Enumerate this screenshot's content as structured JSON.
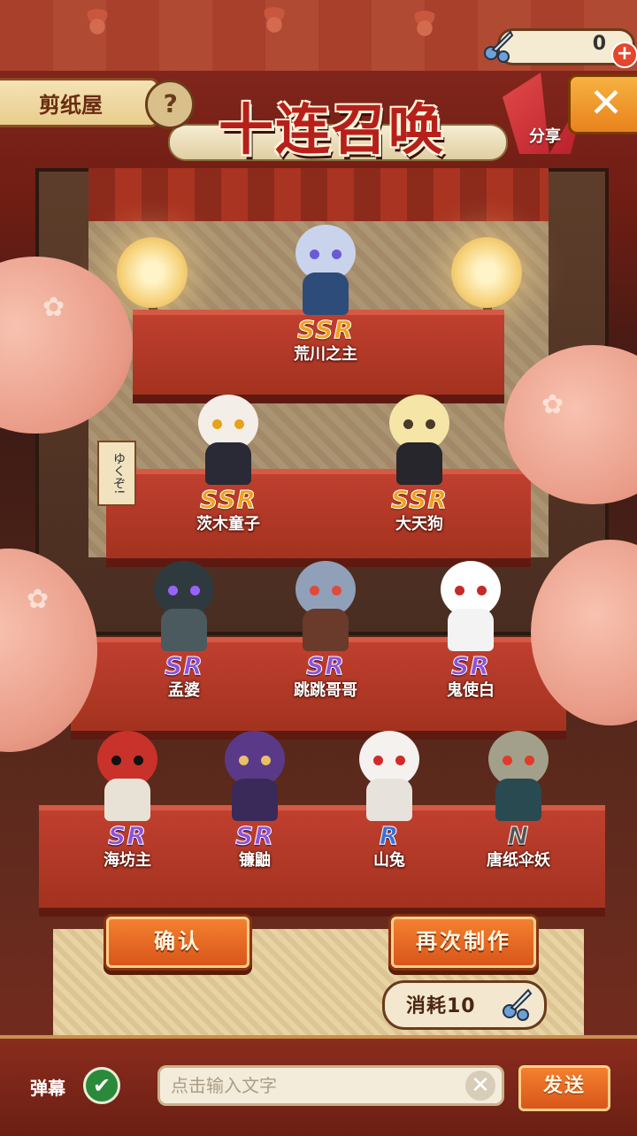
{
  "header": {
    "shop_label": "剪纸屋",
    "help_label": "?",
    "title": "十连召唤",
    "currency_value": "0",
    "currency_plus": "+",
    "share_label": "分享",
    "close_label": "✕"
  },
  "sign_text": "ゆくぞ!",
  "units": [
    {
      "rarity": "SSR",
      "name": "荒川之主",
      "colors": {
        "head": "#c9d3ec",
        "body": "#2e4c7a",
        "eye": "#6a5ad6"
      }
    },
    {
      "rarity": "SSR",
      "name": "茨木童子",
      "colors": {
        "head": "#f3eee8",
        "body": "#2a2a36",
        "eye": "#e8a21a"
      }
    },
    {
      "rarity": "SSR",
      "name": "大天狗",
      "colors": {
        "head": "#f5e6a8",
        "body": "#26262c",
        "eye": "#4a3a2a"
      }
    },
    {
      "rarity": "SR",
      "name": "孟婆",
      "colors": {
        "head": "#2f3a3e",
        "body": "#4a5a5f",
        "eye": "#9a62ff"
      }
    },
    {
      "rarity": "SR",
      "name": "跳跳哥哥",
      "colors": {
        "head": "#8fa0b8",
        "body": "#6a3a2a",
        "eye": "#e04a3a"
      }
    },
    {
      "rarity": "SR",
      "name": "鬼使白",
      "colors": {
        "head": "#ffffff",
        "body": "#f3f3f3",
        "eye": "#c42a2a"
      }
    },
    {
      "rarity": "SR",
      "name": "海坊主",
      "colors": {
        "head": "#c8322a",
        "body": "#e8e2d6",
        "eye": "#111111"
      }
    },
    {
      "rarity": "SR",
      "name": "镰鼬",
      "colors": {
        "head": "#5a3a88",
        "body": "#3a2a5a",
        "eye": "#e8c06a"
      }
    },
    {
      "rarity": "R",
      "name": "山兔",
      "colors": {
        "head": "#f4f1ee",
        "body": "#e8e2dc",
        "eye": "#d22a2a"
      }
    },
    {
      "rarity": "N",
      "name": "唐纸伞妖",
      "colors": {
        "head": "#a2a08a",
        "body": "#2a4a52",
        "eye": "#e23a2a"
      }
    }
  ],
  "buttons": {
    "confirm": "确认",
    "again": "再次制作"
  },
  "cost": {
    "label": "消耗10"
  },
  "bottom": {
    "danmu_label": "弹幕",
    "check": "✔",
    "input_placeholder": "点击输入文字",
    "clear": "✕",
    "send": "发送"
  },
  "colors": {
    "ssr": "#f0a020",
    "sr": "#8e52d6",
    "r": "#3a6fd8",
    "n": "#555555",
    "button": "#e8691f"
  }
}
